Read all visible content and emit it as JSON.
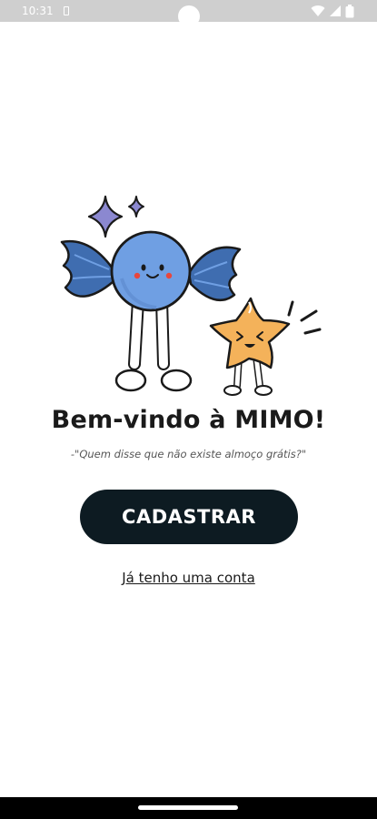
{
  "status_bar": {
    "time": "10:31",
    "icons": [
      "sim-card-icon",
      "wifi-icon",
      "signal-icon",
      "battery-icon"
    ]
  },
  "illustration": {
    "characters": [
      "blue-candy-mascot",
      "orange-star-mascot",
      "sparkle-icon"
    ],
    "colors": {
      "candy_body": "#6f9fe3",
      "candy_wrapper": "#3f6db0",
      "star": "#f4b25a",
      "sparkle": "#8b88d0",
      "cheeks": "#e8463c"
    }
  },
  "welcome": {
    "title": "Bem-vindo à MIMO!",
    "quote": "-\"Quem disse que não existe almoço grátis?\""
  },
  "actions": {
    "register_label": "CADASTRAR",
    "login_label": "Já tenho uma conta"
  },
  "colors": {
    "primary_button": "#0d1b22",
    "background": "#ffffff",
    "text": "#1a1a1a"
  }
}
